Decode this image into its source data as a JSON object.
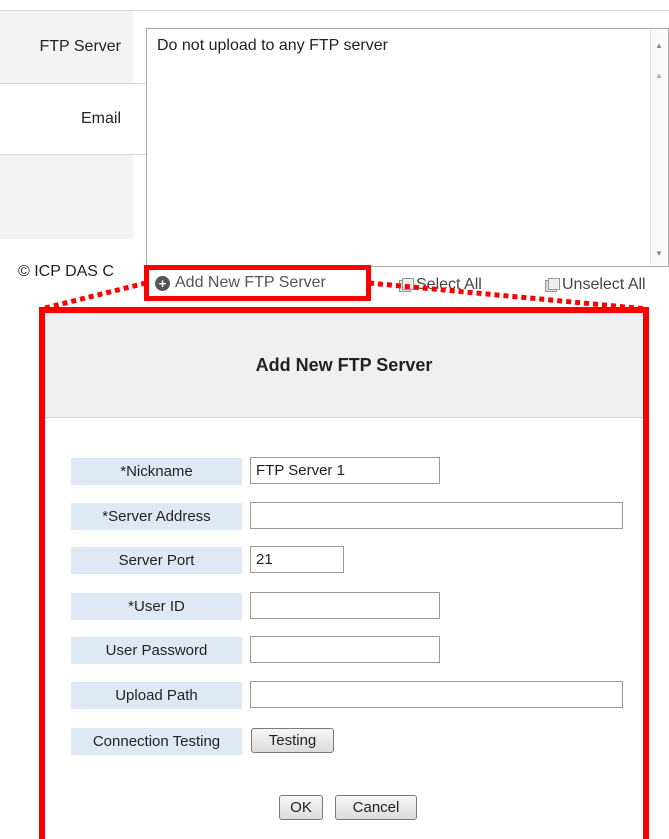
{
  "form_rows": {
    "ftp_server_label": "FTP Server",
    "email_label": "Email"
  },
  "ftp_list": {
    "items": [
      "Do not upload to any FTP server"
    ]
  },
  "footer": {
    "copyright_text": "© ICP DAS C"
  },
  "actions": {
    "add_new_ftp_server": "Add New FTP Server",
    "select_all": "Select All",
    "unselect_all": "Unselect All"
  },
  "dialog": {
    "title": "Add New FTP Server",
    "fields": {
      "nickname": {
        "label": "*Nickname",
        "value": "FTP Server 1"
      },
      "server_address": {
        "label": "*Server Address",
        "value": ""
      },
      "server_port": {
        "label": "Server Port",
        "value": "21"
      },
      "user_id": {
        "label": "*User ID",
        "value": ""
      },
      "user_password": {
        "label": "User Password",
        "value": ""
      },
      "upload_path": {
        "label": "Upload Path",
        "value": ""
      },
      "connection_testing": {
        "label": "Connection Testing",
        "button": "Testing"
      }
    },
    "ok_label": "OK",
    "cancel_label": "Cancel"
  },
  "colors": {
    "highlight": "#ff0000",
    "label_bg": "#dfe9f5",
    "header_bg": "#f0f0f0"
  }
}
